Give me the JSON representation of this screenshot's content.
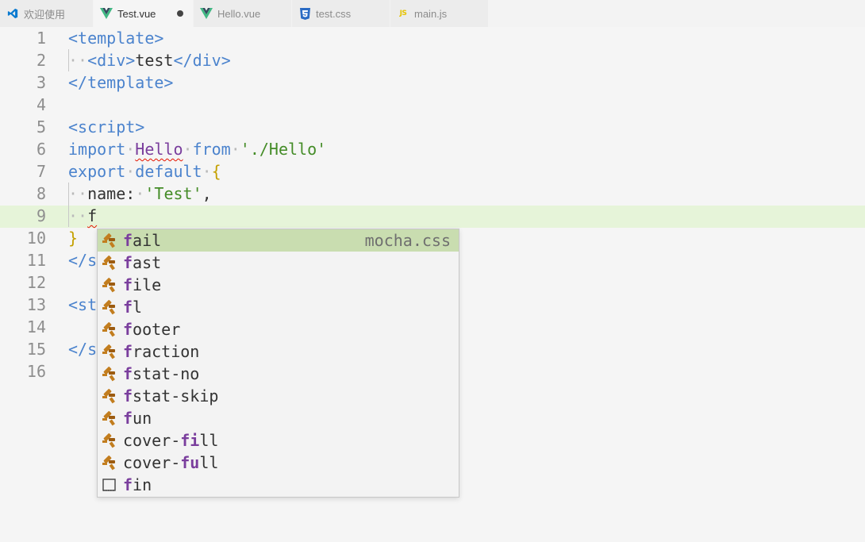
{
  "tabs": [
    {
      "label": "欢迎使用",
      "icon": "vscode-logo-icon",
      "active": false
    },
    {
      "label": "Test.vue",
      "icon": "vue-file-icon",
      "active": true,
      "dirty": true
    },
    {
      "label": "Hello.vue",
      "icon": "vue-file-icon",
      "active": false
    },
    {
      "label": "test.css",
      "icon": "css-file-icon",
      "active": false
    },
    {
      "label": "main.js",
      "icon": "js-file-icon",
      "active": false,
      "badge": "JS"
    }
  ],
  "editor": {
    "line_numbers": [
      "1",
      "2",
      "3",
      "4",
      "5",
      "6",
      "7",
      "8",
      "9",
      "10",
      "11",
      "12",
      "13",
      "14",
      "15",
      "16"
    ],
    "current_line": 9,
    "lines": [
      [
        [
          "tag",
          "<template>"
        ]
      ],
      [
        [
          "ws",
          "··"
        ],
        [
          "tag",
          "<div>"
        ],
        [
          "text",
          "test"
        ],
        [
          "tag",
          "</div>"
        ]
      ],
      [
        [
          "tag",
          "</template>"
        ]
      ],
      [],
      [
        [
          "tag",
          "<script>"
        ]
      ],
      [
        [
          "kw",
          "import"
        ],
        [
          "ws",
          "·"
        ],
        [
          "id_sq",
          "Hello"
        ],
        [
          "ws",
          "·"
        ],
        [
          "kw",
          "from"
        ],
        [
          "ws",
          "·"
        ],
        [
          "str",
          "'./Hello'"
        ]
      ],
      [
        [
          "kw",
          "export"
        ],
        [
          "ws",
          "·"
        ],
        [
          "kw",
          "default"
        ],
        [
          "ws",
          "·"
        ],
        [
          "brace",
          "{"
        ]
      ],
      [
        [
          "ws",
          "··"
        ],
        [
          "text",
          "name:"
        ],
        [
          "ws",
          "·"
        ],
        [
          "str",
          "'Test'"
        ],
        [
          "text",
          ","
        ]
      ],
      [
        [
          "ws",
          "··"
        ],
        [
          "sq",
          "f"
        ]
      ],
      [
        [
          "brace",
          "}"
        ]
      ],
      [
        [
          "tag",
          "</s"
        ]
      ],
      [],
      [
        [
          "tag",
          "<st"
        ]
      ],
      [],
      [
        [
          "tag",
          "</s"
        ]
      ],
      []
    ]
  },
  "suggestions": {
    "detail": "mocha.css",
    "items": [
      {
        "match": "f",
        "rest": "ail",
        "pre": "",
        "icon": "snippet-icon",
        "selected": true
      },
      {
        "match": "f",
        "rest": "ast",
        "pre": "",
        "icon": "snippet-icon"
      },
      {
        "match": "f",
        "rest": "ile",
        "pre": "",
        "icon": "snippet-icon"
      },
      {
        "match": "f",
        "rest": "l",
        "pre": "",
        "icon": "snippet-icon"
      },
      {
        "match": "f",
        "rest": "ooter",
        "pre": "",
        "icon": "snippet-icon"
      },
      {
        "match": "f",
        "rest": "raction",
        "pre": "",
        "icon": "snippet-icon"
      },
      {
        "match": "f",
        "rest": "stat-no",
        "pre": "",
        "icon": "snippet-icon"
      },
      {
        "match": "f",
        "rest": "stat-skip",
        "pre": "",
        "icon": "snippet-icon"
      },
      {
        "match": "f",
        "rest": "un",
        "pre": "",
        "icon": "snippet-icon"
      },
      {
        "match": "fi",
        "rest": "ll",
        "pre": "cover-",
        "icon": "snippet-icon"
      },
      {
        "match": "fu",
        "rest": "ll",
        "pre": "cover-",
        "icon": "snippet-icon"
      },
      {
        "match": "f",
        "rest": "in",
        "pre": "",
        "icon": "text-word-icon"
      }
    ]
  },
  "colors": {
    "tag": "#4b83cd",
    "identifier": "#7a3e9d",
    "string": "#448c27",
    "current_line": "#e6f4d9",
    "selected_suggestion": "#c9ddb0"
  }
}
